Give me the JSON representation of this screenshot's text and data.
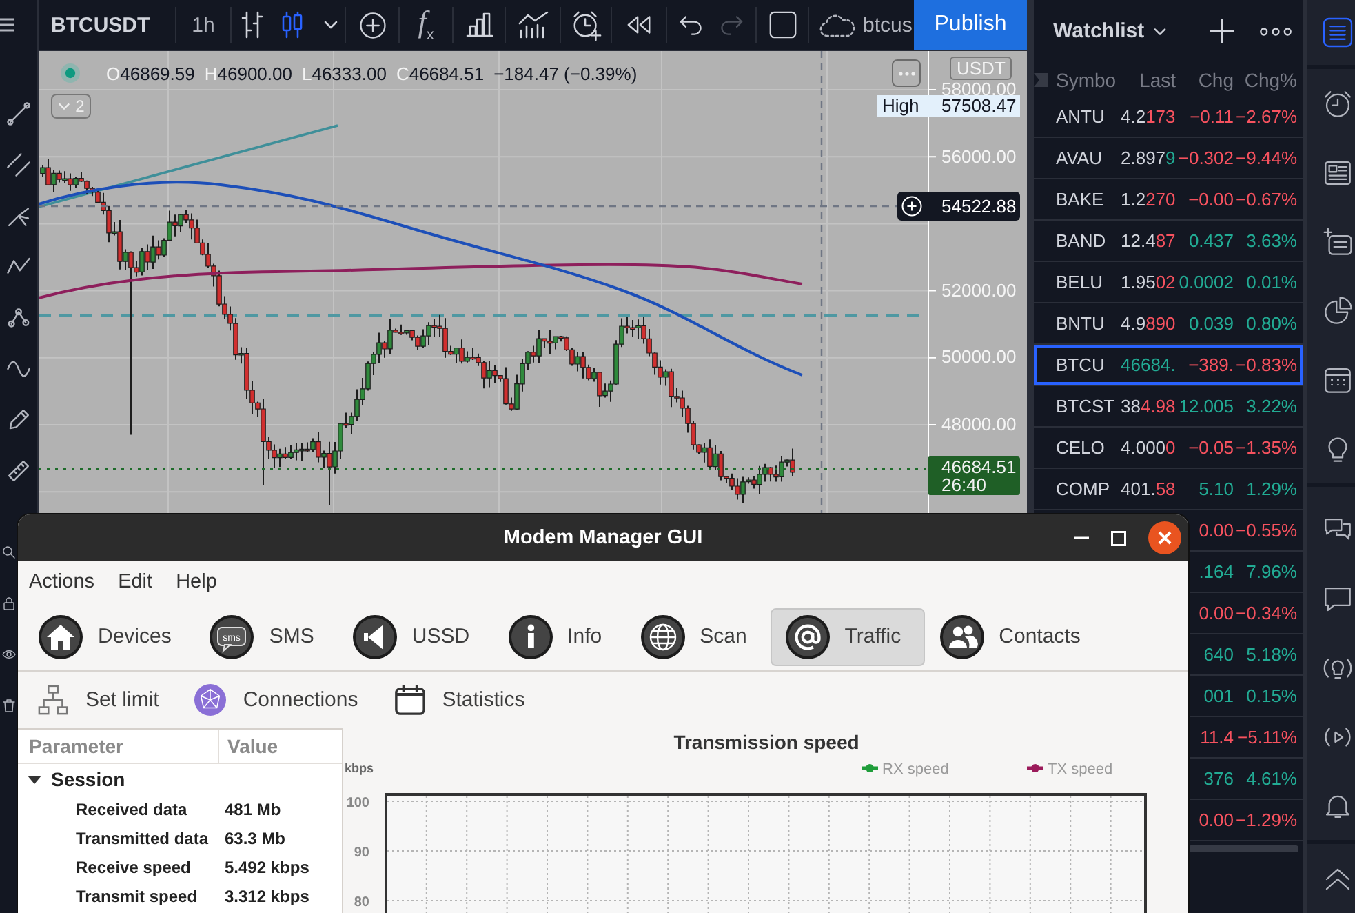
{
  "toolbar": {
    "symbol": "BTCUSDT",
    "interval": "1h",
    "chart_types": [
      {
        "kind": "bars",
        "selected": false
      },
      {
        "kind": "candles",
        "selected": true
      }
    ],
    "indicators": "f$_{x}$",
    "history": [
      {
        "kind": "undo",
        "disabled": false
      },
      {
        "kind": "redo",
        "disabled": true
      }
    ],
    "layout_name": "btcus",
    "publish": "Publish"
  },
  "chart": {
    "legend": {
      "ohlc": [
        {
          "label": "O",
          "value": "46869.59"
        },
        {
          "label": "H",
          "value": "46900.00"
        },
        {
          "label": "L",
          "value": "46333.00"
        },
        {
          "label": "C",
          "value": "46684.51"
        }
      ],
      "change": "−184.47 (−0.39%)"
    },
    "currency": "USDT",
    "indicator_count": "2",
    "price_scale": [
      "58000.00",
      "56000.00",
      "52000.00",
      "50000.00",
      "48000.00"
    ],
    "high": {
      "label": "High",
      "value": "57508.47"
    },
    "crosshair_price": "54522.88",
    "last_price": {
      "value": "46684.51",
      "countdown": "26:40"
    }
  },
  "watchlist": {
    "title": "Watchlist",
    "columns": [
      "Symbo",
      "Last",
      "Chg",
      "Chg%"
    ],
    "rows": [
      {
        "symbol": "ANTU",
        "last": "4.2",
        "last_tick": "173",
        "tick_up": false,
        "chg": "−0.11",
        "chg_pct": "−2.67%",
        "rising": false,
        "selected": false
      },
      {
        "symbol": "AVAU",
        "last": "2.897",
        "last_tick": "9",
        "tick_up": true,
        "chg": "−0.302",
        "chg_pct": "−9.44%",
        "rising": false,
        "selected": false
      },
      {
        "symbol": "BAKE",
        "last": "1.2",
        "last_tick": "270",
        "tick_up": false,
        "chg": "−0.00",
        "chg_pct": "−0.67%",
        "rising": false,
        "selected": false
      },
      {
        "symbol": "BAND",
        "last": "12.4",
        "last_tick": "87",
        "tick_up": false,
        "chg": "0.437",
        "chg_pct": "3.63%",
        "rising": true,
        "selected": false
      },
      {
        "symbol": "BELU",
        "last": "1.95",
        "last_tick": "02",
        "tick_up": false,
        "chg": "0.0002",
        "chg_pct": "0.01%",
        "rising": true,
        "selected": false
      },
      {
        "symbol": "BNTU",
        "last": "4.9",
        "last_tick": "890",
        "tick_up": false,
        "chg": "0.039",
        "chg_pct": "0.80%",
        "rising": true,
        "selected": false
      },
      {
        "symbol": "BTCU",
        "last_tick": "46684.",
        "tick_up": true,
        "chg": "−389.",
        "chg_pct": "−0.83%",
        "rising": false,
        "selected": true
      },
      {
        "symbol": "BTCST",
        "last": "38",
        "last_tick": "4.98",
        "tick_up": false,
        "chg": "12.005",
        "chg_pct": "3.22%",
        "rising": true,
        "selected": false
      },
      {
        "symbol": "CELO",
        "last": "4.000",
        "last_tick": "0",
        "tick_up": false,
        "chg": "−0.05",
        "chg_pct": "−1.35%",
        "rising": false,
        "selected": false
      },
      {
        "symbol": "COMP",
        "last": "401.",
        "last_tick": "58",
        "tick_up": false,
        "chg": "5.10",
        "chg_pct": "1.29%",
        "rising": true,
        "selected": false
      },
      {
        "chg": "0.00",
        "chg_pct": "−0.55%",
        "rising": false,
        "selected": false
      },
      {
        "chg": ".164",
        "chg_pct": "7.96%",
        "rising": true,
        "selected": false
      },
      {
        "chg": "0.00",
        "chg_pct": "−0.34%",
        "rising": false,
        "selected": false
      },
      {
        "chg": "640",
        "chg_pct": "5.18%",
        "rising": true,
        "selected": false
      },
      {
        "chg": "001",
        "chg_pct": "0.15%",
        "rising": true,
        "selected": false
      },
      {
        "chg": "11.4",
        "chg_pct": "−5.11%",
        "rising": false,
        "selected": false
      },
      {
        "chg": "376",
        "chg_pct": "4.61%",
        "rising": true,
        "selected": false
      },
      {
        "chg": "0.00",
        "chg_pct": "−1.29%",
        "rising": false,
        "selected": false
      }
    ]
  },
  "side_panel": [
    {
      "kind": "watchlist",
      "selected": true
    },
    {
      "kind": "alerts",
      "selected": false
    },
    {
      "kind": "news",
      "selected": false
    },
    {
      "kind": "lists",
      "selected": false
    },
    {
      "kind": "hotlists",
      "selected": false
    },
    {
      "kind": "calendar",
      "selected": false
    },
    {
      "kind": "ideas",
      "selected": false
    },
    {
      "kind": "chats",
      "selected": false
    },
    {
      "kind": "private_chats",
      "selected": false
    },
    {
      "kind": "ideas_stream",
      "selected": false
    },
    {
      "kind": "streams",
      "selected": false
    },
    {
      "kind": "notifications",
      "selected": false
    },
    {
      "kind": "collapse",
      "selected": false
    }
  ],
  "modem_window": {
    "title": "Modem Manager GUI",
    "menu": [
      "Actions",
      "Edit",
      "Help"
    ],
    "tabs": [
      {
        "label": "Devices",
        "kind": "devices",
        "selected": false
      },
      {
        "label": "SMS",
        "kind": "sms",
        "icon_text": "sms",
        "selected": false
      },
      {
        "label": "USSD",
        "kind": "ussd",
        "selected": false
      },
      {
        "label": "Info",
        "kind": "info",
        "selected": false
      },
      {
        "label": "Scan",
        "kind": "scan",
        "selected": false
      },
      {
        "label": "Traffic",
        "kind": "traffic",
        "selected": true
      },
      {
        "label": "Contacts",
        "kind": "contacts",
        "selected": false
      }
    ],
    "tools": [
      {
        "label": "Set limit",
        "kind": "limit"
      },
      {
        "label": "Connections",
        "kind": "connections"
      },
      {
        "label": "Statistics",
        "kind": "statistics"
      }
    ],
    "table": {
      "columns": [
        "Parameter",
        "Value"
      ],
      "groups": [
        {
          "label": "Session",
          "expanded": true,
          "children": [
            {
              "parameter": "Received data",
              "value": "481 Mb"
            },
            {
              "parameter": "Transmitted data",
              "value": "63.3 Mb"
            },
            {
              "parameter": "Receive speed",
              "value": "5.492 kbps"
            },
            {
              "parameter": "Transmit speed",
              "value": "3.312 kbps"
            }
          ]
        }
      ]
    },
    "chart_data": {
      "type": "line",
      "title": "Transmission speed",
      "ylabel": "kbps",
      "series": [
        {
          "name": "RX speed",
          "color": "#1f9d3a"
        },
        {
          "name": "TX speed",
          "color": "#9b1a5a"
        }
      ],
      "ylim": [
        0,
        101.4
      ],
      "yticks": [
        80,
        90,
        100
      ],
      "grid": true
    }
  }
}
